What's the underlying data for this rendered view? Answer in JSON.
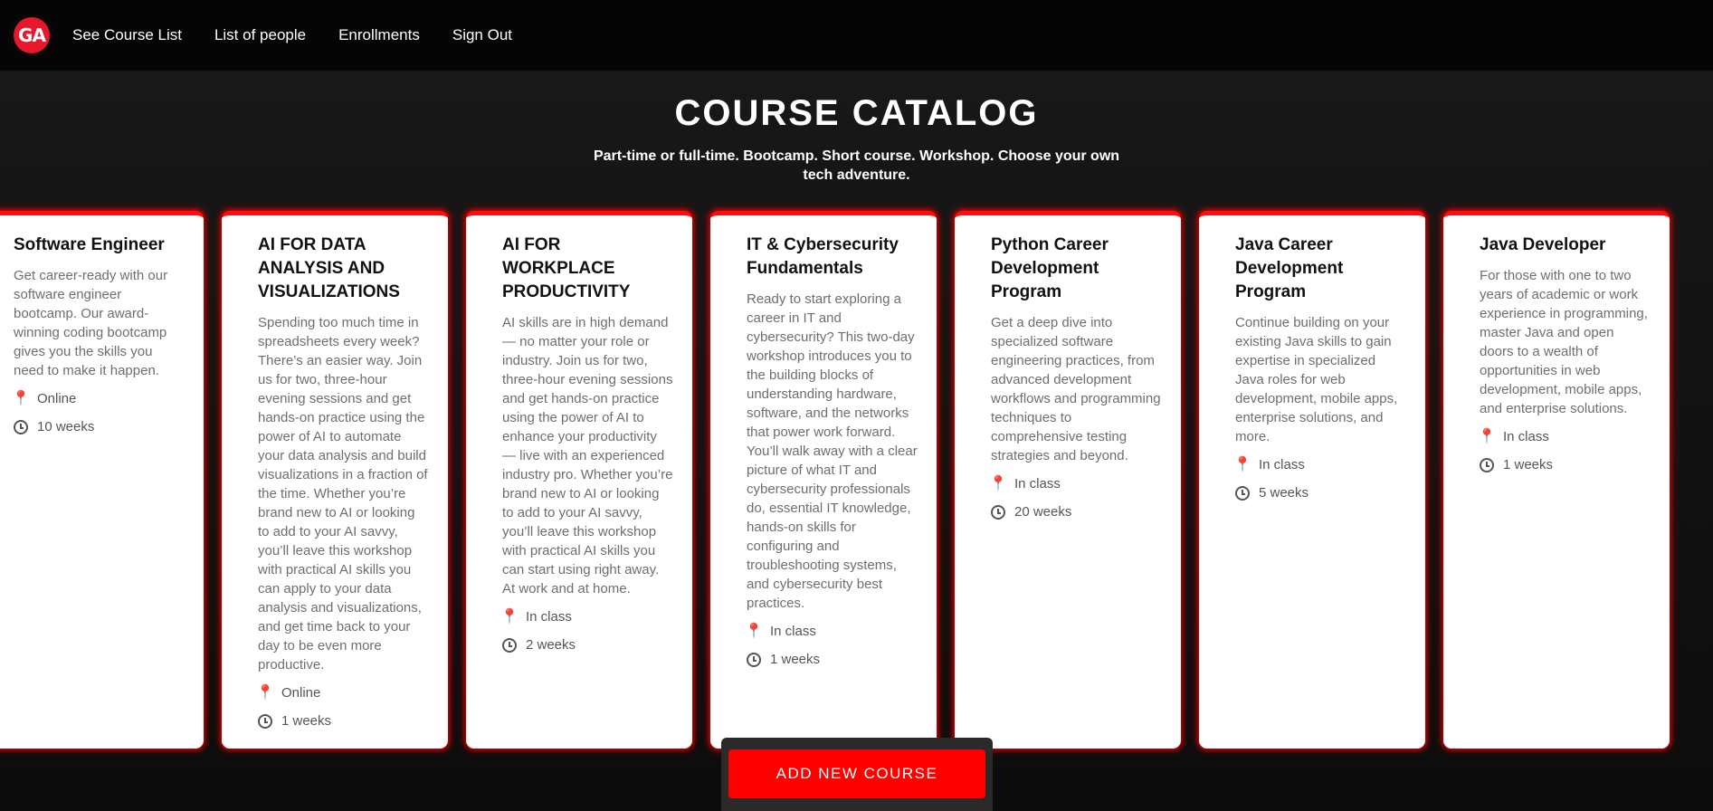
{
  "logo": {
    "text": "GA"
  },
  "nav": {
    "courses": "See Course List",
    "people": "List of people",
    "enrollments": "Enrollments",
    "signout": "Sign Out"
  },
  "header": {
    "title": "COURSE CATALOG",
    "subtitle": "Part-time or full-time. Bootcamp. Short course. Workshop. Choose your own tech adventure."
  },
  "courses": [
    {
      "title": "Software Engineer",
      "description": "Get career-ready with our software engineer bootcamp. Our award-winning coding bootcamp gives you the skills you need to make it happen.",
      "format": "Online",
      "duration": "10 weeks"
    },
    {
      "title": "AI FOR DATA ANALYSIS AND VISUALIZATIONS",
      "description": "Spending too much time in spreadsheets every week? There’s an easier way. Join us for two, three-hour evening sessions and get hands-on practice using the power of AI to automate your data analysis and build visualizations in a fraction of the time. Whether you’re brand new to AI or looking to add to your AI savvy, you’ll leave this workshop with practical AI skills you can apply to your data analysis and visualizations, and get time back to your day to be even more productive.",
      "format": "Online",
      "duration": "1 weeks"
    },
    {
      "title": "AI FOR WORKPLACE PRODUCTIVITY",
      "description": "AI skills are in high demand — no matter your role or industry. Join us for two, three-hour evening sessions and get hands-on practice using the power of AI to enhance your productivity — live with an experienced industry pro. Whether you’re brand new to AI or looking to add to your AI savvy, you’ll leave this workshop with practical AI skills you can start using right away. At work and at home.",
      "format": "In class",
      "duration": "2 weeks"
    },
    {
      "title": "IT & Cybersecurity Fundamentals",
      "description": "Ready to start exploring a career in IT and cybersecurity? This two-day workshop introduces you to the building blocks of understanding hardware, software, and the networks that power work forward. You’ll walk away with a clear picture of what IT and cybersecurity professionals do, essential IT knowledge, hands-on skills for configuring and troubleshooting systems, and cybersecurity best practices.",
      "format": "In class",
      "duration": "1 weeks"
    },
    {
      "title": "Python Career Development Program",
      "description": "Get a deep dive into specialized software engineering practices, from advanced development workflows and programming techniques to comprehensive testing strategies and beyond.",
      "format": "In class",
      "duration": "20 weeks"
    },
    {
      "title": "Java Career Development Program",
      "description": "Continue building on your existing Java skills to gain expertise in specialized Java roles for web development, mobile apps, enterprise solutions, and more.",
      "format": "In class",
      "duration": "5 weeks"
    },
    {
      "title": "Java Developer",
      "description": "For those with one to two years of academic or work experience in programming, master Java and open doors to a wealth of opportunities in web development, mobile apps, and enterprise solutions.",
      "format": "In class",
      "duration": "1 weeks"
    }
  ],
  "actions": {
    "add_course": "ADD NEW COURSE"
  },
  "colors": {
    "accent": "#ff0000",
    "pin": "#e8177d",
    "logo": "#e8172b"
  }
}
